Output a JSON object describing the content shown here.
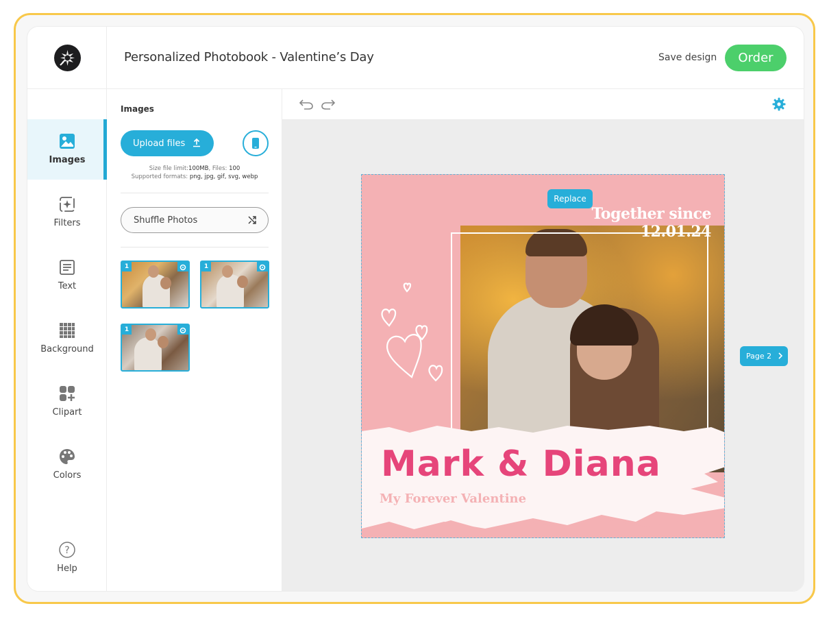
{
  "header": {
    "title": "Personalized Photobook - Valentine’s Day",
    "save_label": "Save design",
    "order_label": "Order"
  },
  "sidebar": {
    "items": [
      {
        "label": "Images",
        "icon": "image-icon",
        "active": true
      },
      {
        "label": "Filters",
        "icon": "sparkle-filter-icon"
      },
      {
        "label": "Text",
        "icon": "text-icon"
      },
      {
        "label": "Background",
        "icon": "grid-icon"
      },
      {
        "label": "Clipart",
        "icon": "clipart-icon"
      },
      {
        "label": "Colors",
        "icon": "palette-icon"
      },
      {
        "label": "Help",
        "icon": "help-icon"
      }
    ]
  },
  "panel": {
    "title": "Images",
    "upload_label": "Upload files",
    "limits_prefix": "Size file limit:",
    "limits_size": "100MB",
    "limits_files_prefix": ", Files:",
    "limits_files": "100",
    "limits_formats_prefix": "Supported formats:",
    "limits_formats": "png, jpg, gif, svg, webp",
    "shuffle_label": "Shuffle Photos",
    "thumbnails": [
      {
        "badge": "1"
      },
      {
        "badge": "1"
      },
      {
        "badge": "1"
      }
    ]
  },
  "canvas": {
    "replace_label": "Replace",
    "together_text": "Together since 12.01.24",
    "names_text": "Mark & Diana",
    "subtitle_text": "My Forever Valentine",
    "next_page_label": "Page 2"
  },
  "colors": {
    "accent": "#27aed9",
    "order": "#4ccf6b",
    "page_bg": "#f4b1b4",
    "names": "#e6457a",
    "frame": "#f8c84a"
  }
}
